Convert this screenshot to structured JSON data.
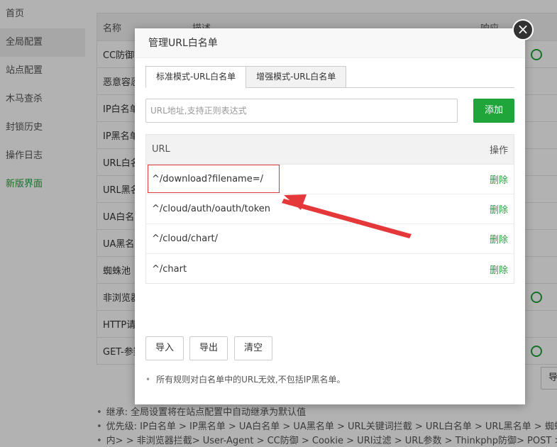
{
  "sidebar": {
    "items": [
      {
        "label": "首页"
      },
      {
        "label": "全局配置"
      },
      {
        "label": "站点配置"
      },
      {
        "label": "木马查杀"
      },
      {
        "label": "封锁历史"
      },
      {
        "label": "操作日志"
      },
      {
        "label": "新版界面"
      }
    ]
  },
  "bg_table": {
    "headers": [
      "名称",
      "描述",
      "响应"
    ],
    "rows": [
      "CC防御",
      "恶意容忍",
      "IP白名单",
      "IP黑名单",
      "URL白名单",
      "URL黑名单",
      "UA白名单",
      "UA黑名单",
      "蜘蛛池",
      "非浏览器",
      "HTTP请求",
      "GET-参数"
    ]
  },
  "bg_edge_button": "导",
  "bg_notes": [
    "继承: 全局设置将在站点配置中自动继承为默认值",
    "优先级: IP白名单 > IP黑名单 > UA白名单 > UA黑名单 > URL关键词拦截 > URL白名单 > URL黑名单 > 蜘蛛池",
    "内> > 非浏览器拦截> User-Agent > CC防御 > Cookie > URI过滤 > URL参数 > Thinkphp防御> POST > 网"
  ],
  "modal": {
    "title": "管理URL白名单",
    "close_glyph": "×",
    "tabs": [
      {
        "label": "标准模式-URL白名单",
        "active": true
      },
      {
        "label": "增强模式-URL白名单",
        "active": false
      }
    ],
    "input_placeholder": "URL地址,支持正则表达式",
    "add_label": "添加",
    "table": {
      "col_url": "URL",
      "col_action": "操作",
      "rows": [
        {
          "url": "^/download?filename=/",
          "action": "删除"
        },
        {
          "url": "^/cloud/auth/oauth/token",
          "action": "删除"
        },
        {
          "url": "^/cloud/chart/",
          "action": "删除"
        },
        {
          "url": "^/chart",
          "action": "删除"
        }
      ]
    },
    "buttons": {
      "import": "导入",
      "export": "导出",
      "clear": "清空"
    },
    "note": "所有规则对白名单中的URL无效,不包括IP黑名单。"
  },
  "colors": {
    "accent": "#20a53a",
    "annotation": "#e5383b"
  }
}
